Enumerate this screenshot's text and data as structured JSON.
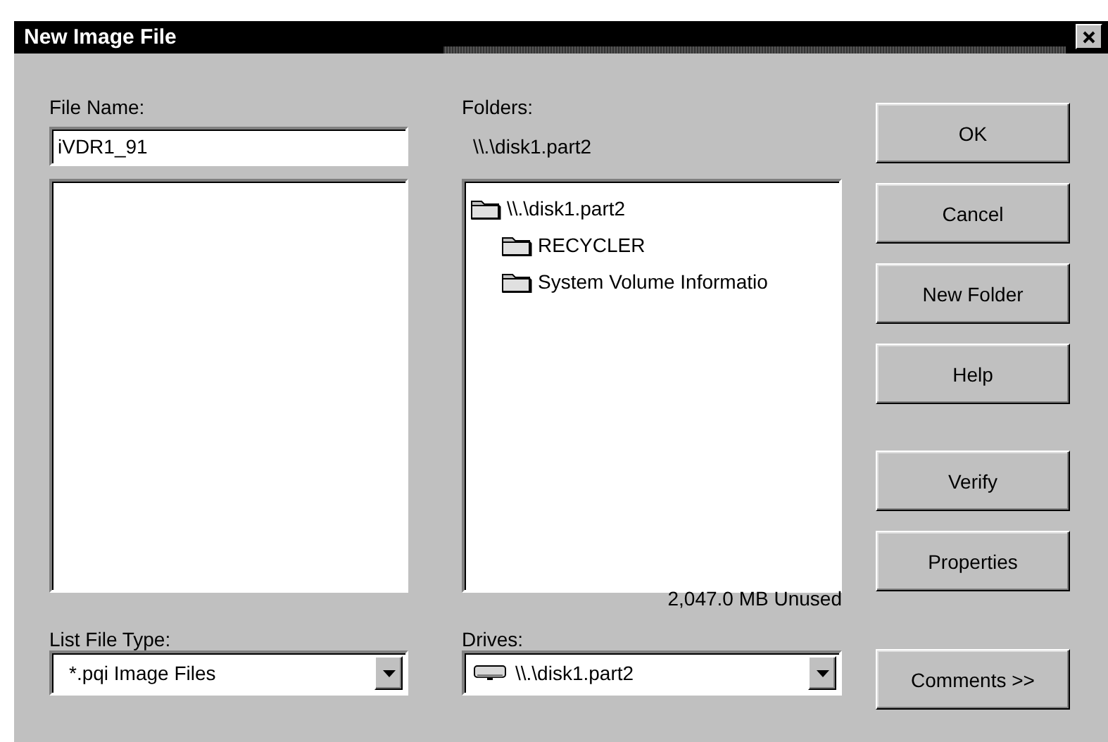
{
  "window": {
    "title": "New Image File"
  },
  "file_name": {
    "label": "File Name:",
    "value": "iVDR1_91"
  },
  "file_type": {
    "label": "List File Type:",
    "value": "*.pqi  Image Files"
  },
  "folders": {
    "label": "Folders:",
    "path": "\\\\.\\disk1.part2",
    "tree": [
      {
        "label": "\\\\.\\disk1.part2",
        "children": [
          {
            "label": "RECYCLER"
          },
          {
            "label": "System Volume Informatio"
          }
        ]
      }
    ]
  },
  "drives": {
    "label": "Drives:",
    "free": "2,047.0 MB Unused",
    "value": "\\\\.\\disk1.part2"
  },
  "button_groups": [
    [
      "OK",
      "Cancel",
      "New Folder",
      "Help"
    ],
    [
      "Verify",
      "Properties"
    ],
    [
      "Comments >>"
    ]
  ]
}
